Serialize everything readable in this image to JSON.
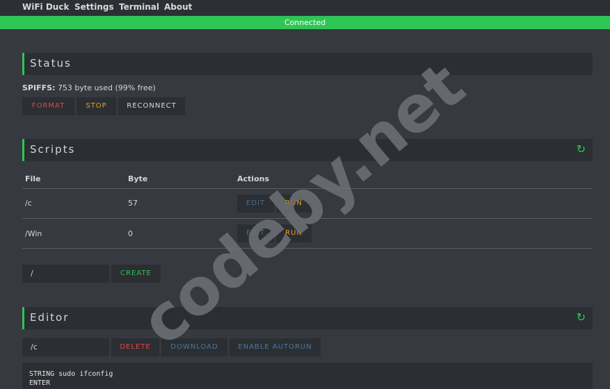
{
  "nav": {
    "items": [
      "WiFi Duck",
      "Settings",
      "Terminal",
      "About"
    ]
  },
  "connection": {
    "status": "Connected",
    "color": "#2ec655"
  },
  "status_section": {
    "title": "Status",
    "spiffs_label": "SPIFFS:",
    "spiffs_value": "753 byte used (99% free)",
    "buttons": {
      "format": "FORMAT",
      "stop": "STOP",
      "reconnect": "RECONNECT"
    }
  },
  "scripts_section": {
    "title": "Scripts",
    "refresh_icon": "refresh-icon",
    "columns": [
      "File",
      "Byte",
      "Actions"
    ],
    "rows": [
      {
        "file": "/c",
        "bytes": "57",
        "edit": "EDIT",
        "run": "RUN"
      },
      {
        "file": "/Win",
        "bytes": "0",
        "edit": "EDIT",
        "run": "RUN"
      }
    ],
    "new_file_value": "/",
    "create_label": "CREATE"
  },
  "editor_section": {
    "title": "Editor",
    "refresh_icon": "refresh-icon",
    "filename_value": "/c",
    "buttons": {
      "delete": "DELETE",
      "download": "DOWNLOAD",
      "autorun": "ENABLE AUTORUN"
    },
    "content": "STRING sudo ifconfig\nENTER"
  },
  "watermark": {
    "text": "codeby.net"
  },
  "colors": {
    "accent": "#2ec655",
    "danger": "#e04848",
    "warning": "#f0a020",
    "link": "#4a78a8",
    "background": "#36393f",
    "panel": "#2b2e32"
  }
}
